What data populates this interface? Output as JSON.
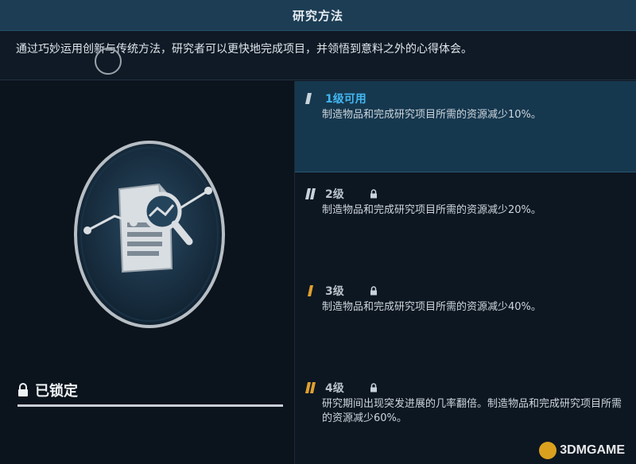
{
  "header": {
    "title": "研究方法"
  },
  "description": "通过巧妙运用创新与传统方法，研究者可以更快地完成项目，并领悟到意料之外的心得体会。",
  "left": {
    "locked_label": "已锁定",
    "emblem_icon": "document-magnifier-chart-icon"
  },
  "tiers": [
    {
      "name": "1级可用",
      "text": "制造物品和完成研究项目所需的资源减少10%。",
      "locked": false,
      "active": true
    },
    {
      "name": "2级",
      "text": "制造物品和完成研究项目所需的资源减少20%。",
      "locked": true,
      "active": false
    },
    {
      "name": "3级",
      "text": "制造物品和完成研究项目所需的资源减少40%。",
      "locked": true,
      "active": false
    },
    {
      "name": "4级",
      "text": "研究期间出现突发进展的几率翻倍。制造物品和完成研究项目所需的资源减少60%。",
      "locked": true,
      "active": false
    }
  ],
  "colors": {
    "active_tier_bg": "#16384f",
    "active_tier_text": "#42b6f0",
    "tier_mark_active": "#c9d3db",
    "tier_mark_tier2": "#c9d3db",
    "tier_mark_tier3": "#e0a030",
    "tier_mark_tier4": "#e0a030"
  },
  "watermark": {
    "text": "3DMGAME"
  }
}
